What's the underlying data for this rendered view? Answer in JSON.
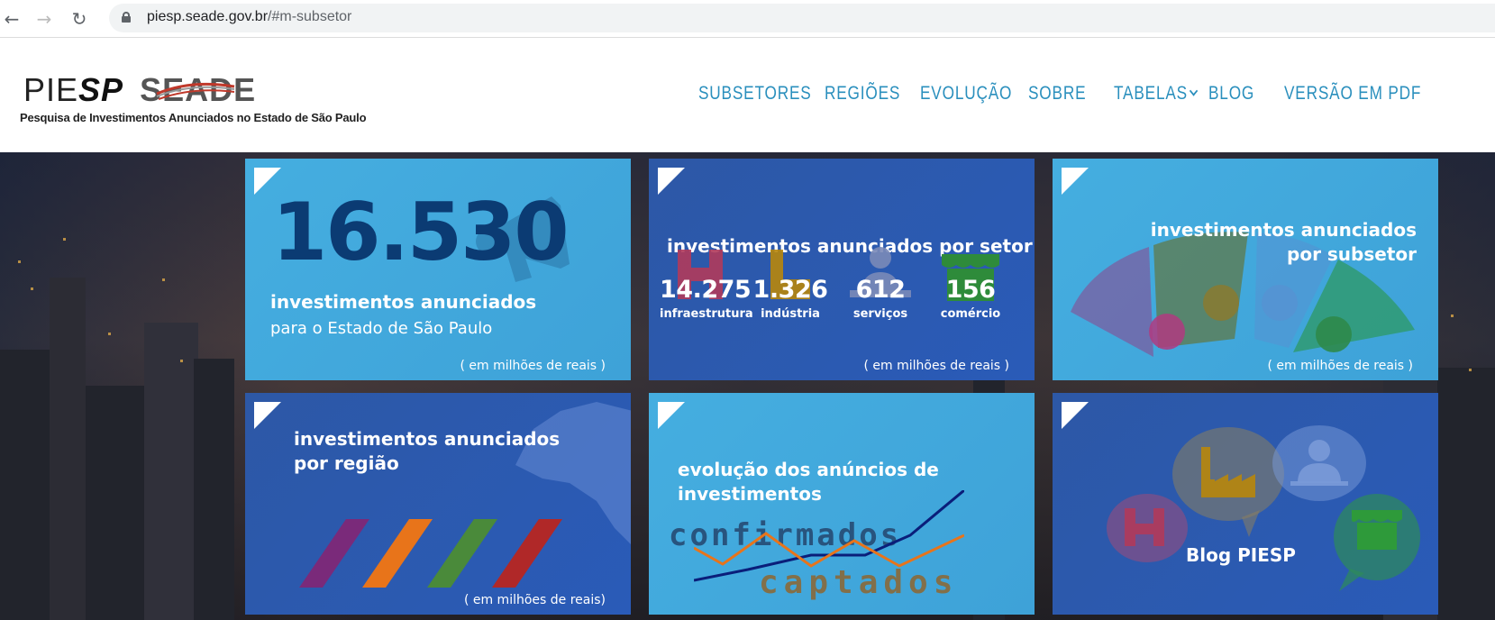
{
  "browser": {
    "url_host": "piesp.seade.gov.br",
    "url_path": "/#m-subsetor"
  },
  "logo": {
    "part1": "PIE",
    "part2": "SP",
    "part3": "SEADE",
    "tagline": "Pesquisa de Investimentos Anunciados no Estado de São Paulo"
  },
  "nav": {
    "items": [
      "SUBSETORES",
      "REGIÕES",
      "EVOLUÇÃO",
      "SOBRE",
      "TABELAS",
      "BLOG",
      "VERSÃO EM PDF"
    ]
  },
  "tiles": {
    "total": {
      "value": "16.530",
      "title": "investimentos anunciados",
      "subtitle": "para o Estado de São Paulo",
      "unit": "( em milhões de reais )"
    },
    "setor": {
      "title": "investimentos anunciados por setor",
      "sectors": [
        {
          "value": "14.275",
          "label": "infraestrutura",
          "icon": "crane-icon"
        },
        {
          "value": "1.326",
          "label": "indústria",
          "icon": "factory-icon"
        },
        {
          "value": "612",
          "label": "serviços",
          "icon": "worker-icon"
        },
        {
          "value": "156",
          "label": "comércio",
          "icon": "store-icon"
        }
      ],
      "unit": "( em milhões de reais )"
    },
    "subsetor": {
      "title_line1": "investimentos anunciados",
      "title_line2": "por subsetor",
      "unit": "( em milhões de reais )"
    },
    "regiao": {
      "title_line1": "investimentos anunciados",
      "title_line2": "por região",
      "unit": "( em milhões de reais)"
    },
    "evolucao": {
      "title_line1": "evolução dos anúncios de",
      "title_line2": "investimentos",
      "word1": "confirmados",
      "word2": "captados"
    },
    "blog": {
      "title": "Blog PIESP"
    }
  },
  "colors": {
    "nav": "#2a8fbd",
    "tile_light": "#42a9dd",
    "tile_dark": "#2c59b0",
    "big_number": "#0b3b73"
  }
}
